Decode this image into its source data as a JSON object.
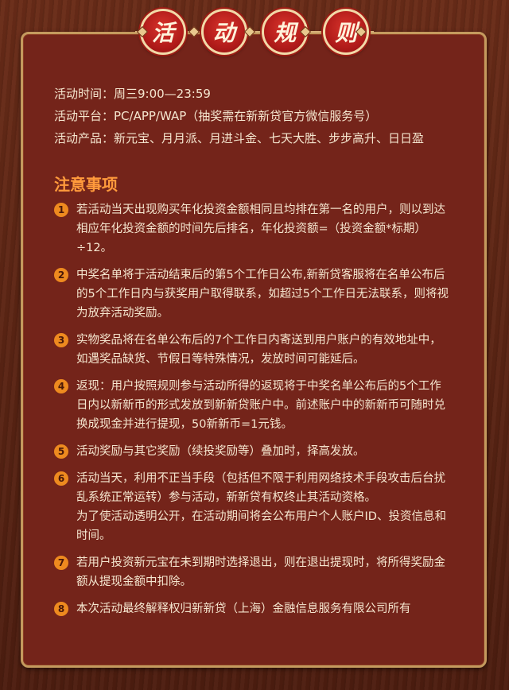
{
  "title_chars": [
    "活",
    "动",
    "规",
    "则"
  ],
  "info": {
    "time": "活动时间：周三9:00—23:59",
    "platform": "活动平台：PC/APP/WAP（抽奖需在新新贷官方微信服务号）",
    "products": "活动产品：新元宝、月月派、月进斗金、七天大胜、步步高升、日日盈"
  },
  "notice_title": "注意事项",
  "rules": [
    {
      "num": "1",
      "text": "若活动当天出现购买年化投资金额相同且均排在第一名的用户，则以到达相应年化投资金额的时间先后排名，年化投资额=（投资金额*标期）÷12。"
    },
    {
      "num": "2",
      "text": "中奖名单将于活动结束后的第5个工作日公布,新新贷客服将在名单公布后的5个工作日内与获奖用户取得联系，如超过5个工作日无法联系，则将视为放弃活动奖励。"
    },
    {
      "num": "3",
      "text": "实物奖品将在名单公布后的7个工作日内寄送到用户账户的有效地址中，如遇奖品缺货、节假日等特殊情况，发放时间可能延后。"
    },
    {
      "num": "4",
      "text": "返现：用户按照规则参与活动所得的返现将于中奖名单公布后的5个工作日内以新新币的形式发放到新新贷账户中。前述账户中的新新币可随时兑换成现金并进行提现，50新新币=1元钱。"
    },
    {
      "num": "5",
      "text": "活动奖励与其它奖励（续投奖励等）叠加时，择高发放。"
    },
    {
      "num": "6",
      "text": "活动当天，利用不正当手段（包括但不限于利用网络技术手段攻击后台扰乱系统正常运转）参与活动，新新贷有权终止其活动资格。",
      "extra": "为了使活动透明公开，在活动期间将会公布用户个人账户ID、投资信息和时间。"
    },
    {
      "num": "7",
      "text": "若用户投资新元宝在未到期时选择退出，则在退出提现时，将所得奖励金额从提现金额中扣除。"
    },
    {
      "num": "8",
      "text": "本次活动最终解释权归新新贷（上海）金融信息服务有限公司所有"
    }
  ],
  "colors": {
    "background": "#5a2414",
    "panel": "#74241a",
    "panel_border": "#c49a5e",
    "medal_red": "#b21c1a",
    "accent_orange": "#ff9a3c",
    "text": "#f5e6cf"
  }
}
